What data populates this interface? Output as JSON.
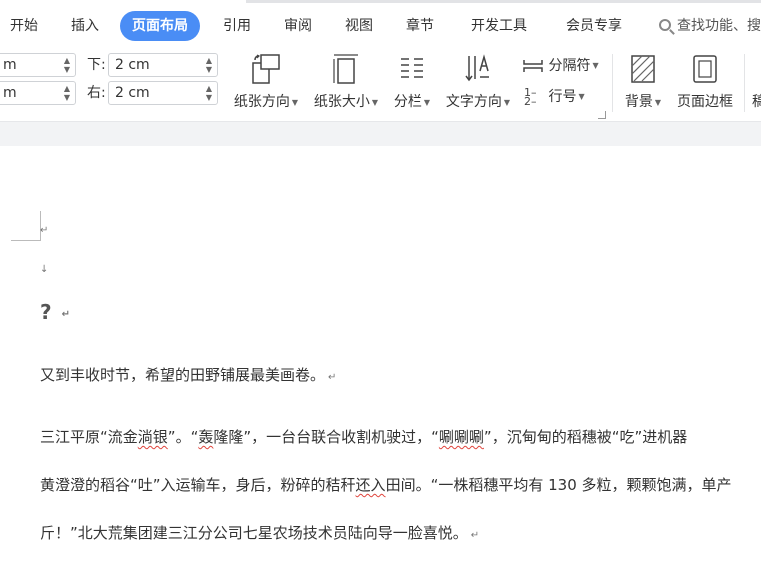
{
  "tabs": [
    {
      "label": "开始",
      "active": false
    },
    {
      "label": "插入",
      "active": false
    },
    {
      "label": "页面布局",
      "active": true
    },
    {
      "label": "引用",
      "active": false
    },
    {
      "label": "审阅",
      "active": false
    },
    {
      "label": "视图",
      "active": false
    },
    {
      "label": "章节",
      "active": false
    },
    {
      "label": "开发工具",
      "active": false
    },
    {
      "label": "会员专享",
      "active": false
    }
  ],
  "search": {
    "text": "查找功能、搜"
  },
  "margins": {
    "top_value": "m",
    "bottom_label": "下:",
    "bottom_value": "2 cm",
    "left_value": "m",
    "right_label": "右:",
    "right_value": "2 cm"
  },
  "ribbon": {
    "orientation": "纸张方向",
    "size": "纸张大小",
    "columns": "分栏",
    "text_direction": "文字方向",
    "breaks": "分隔符",
    "line_numbers": "行号",
    "background": "背景",
    "page_border": "页面边框",
    "cut_off": "稿"
  },
  "document": {
    "question_mark": "?",
    "p1": "又到丰收时节，希望的田野铺展最美画卷。",
    "p2a": "三江平原“流金",
    "p2_squig1": "淌银",
    "p2b": "”。“",
    "p2_squig2": "轰",
    "p2c": "隆隆”，一台台联合收割机驶过，“",
    "p2_squig3": "唰唰唰",
    "p2d": "”，沉甸甸的稻穗被“吃”进机器",
    "p3a": "黄澄澄的稻谷“吐”入运输车，身后，粉碎的秸秆",
    "p3_squig": "还入",
    "p3b": "田间。“一株稻穗平均有 130 多粒，颗颗饱满，单产",
    "p4": "斤！”北大荒集团建三江分公司七星农场技术员陆向导一脸喜悦。"
  }
}
